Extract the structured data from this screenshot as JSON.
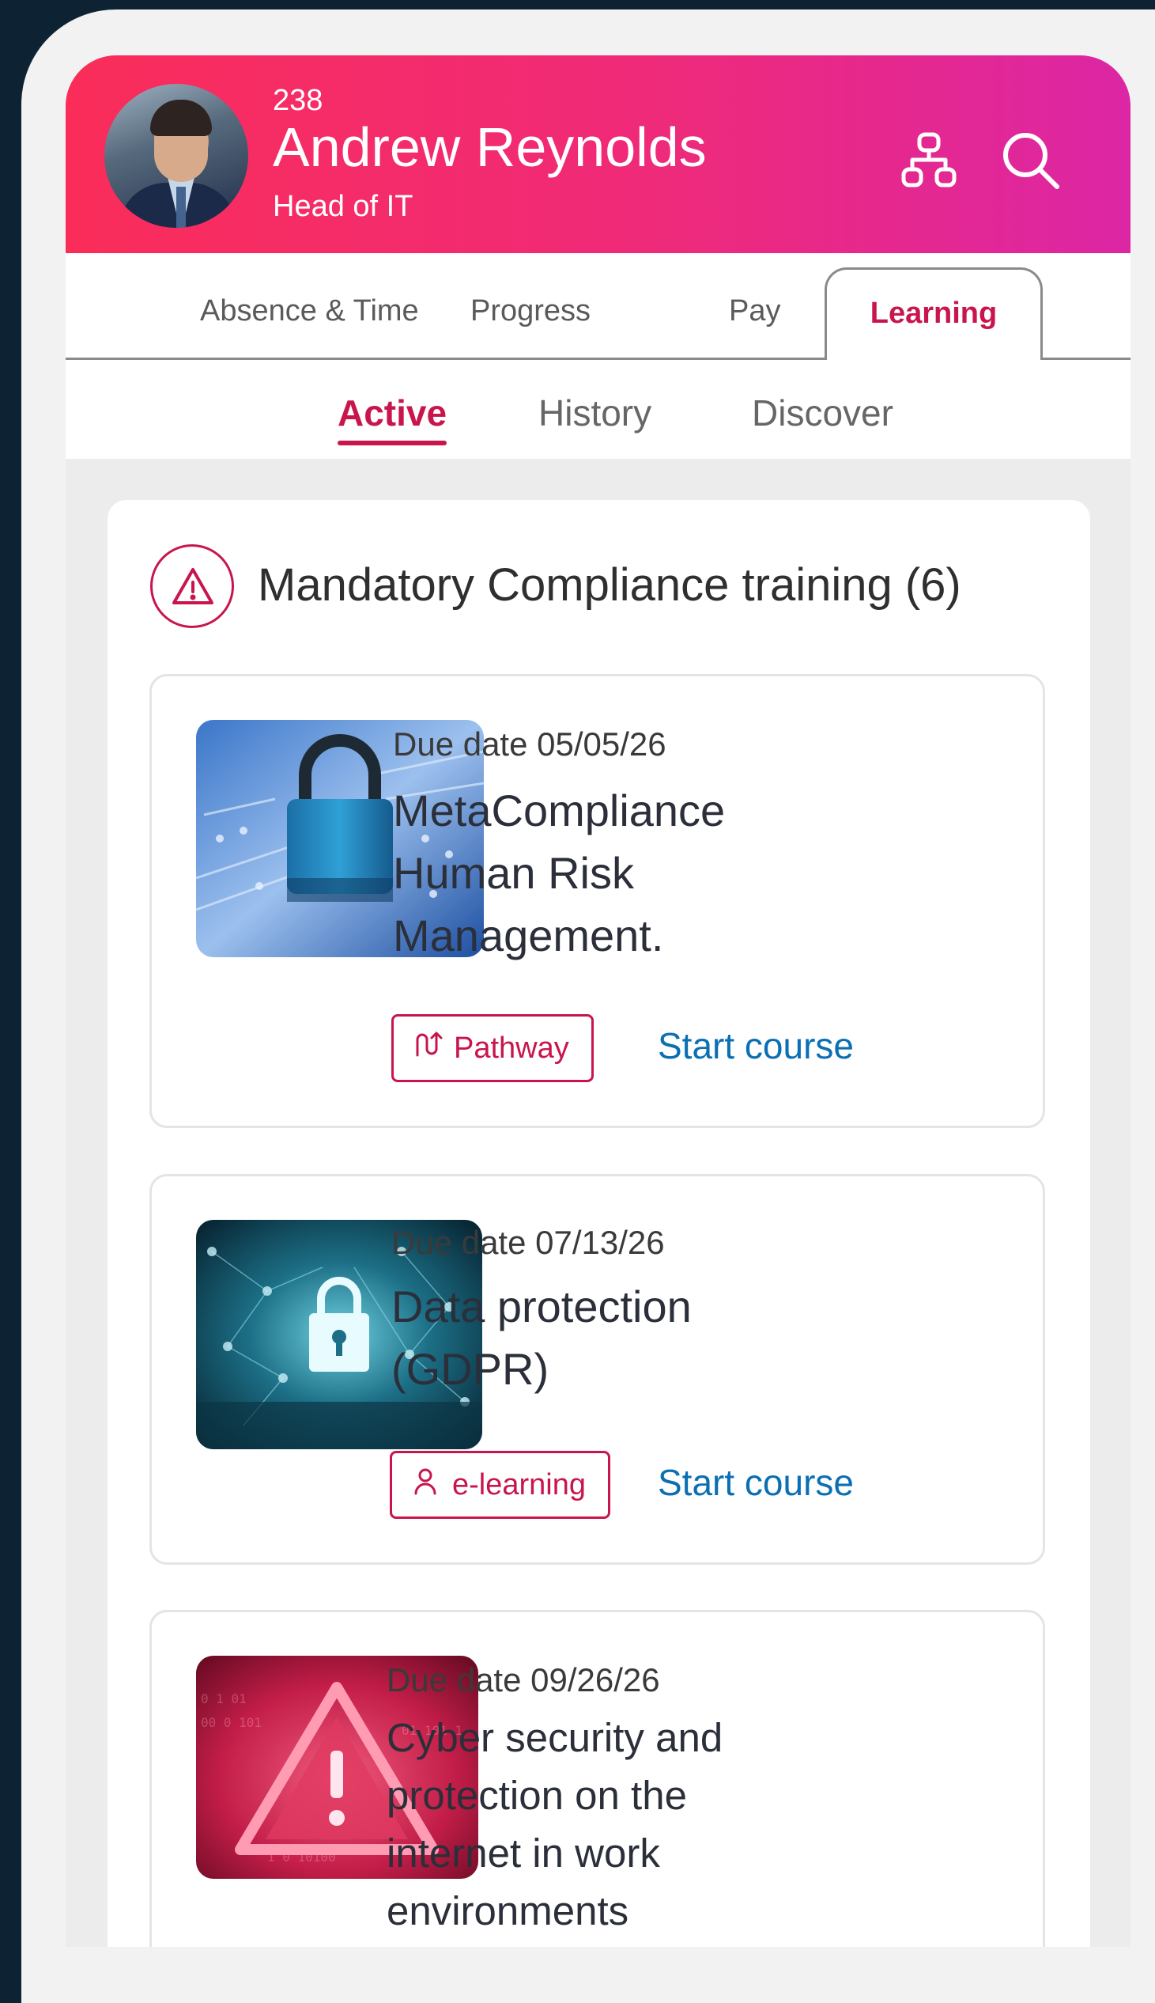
{
  "header": {
    "number": "238",
    "name": "Andrew Reynolds",
    "role": "Head of IT",
    "icons": [
      "org-chart-icon",
      "search-icon"
    ]
  },
  "tabs": [
    {
      "label": "Absence & Time",
      "active": false
    },
    {
      "label": "Progress",
      "active": false
    },
    {
      "label": "Pay",
      "active": false
    },
    {
      "label": "Learning",
      "active": true
    }
  ],
  "subtabs": [
    {
      "label": "Active",
      "active": true
    },
    {
      "label": "History",
      "active": false
    },
    {
      "label": "Discover",
      "active": false
    }
  ],
  "section": {
    "title": "Mandatory Compliance training (6)",
    "icon": "warning-icon"
  },
  "courses": [
    {
      "due": "Due date 05/05/26",
      "title_lines": [
        "MetaCompliance",
        "Human Risk",
        "Management."
      ],
      "type": "Pathway",
      "type_icon": "pathway-icon",
      "action": "Start course",
      "image": "padlock-circuit-image"
    },
    {
      "due": "Due date 07/13/26",
      "title_lines": [
        "Data protection",
        "(GDPR)"
      ],
      "type": "e-learning",
      "type_icon": "person-icon",
      "action": "Start course",
      "image": "network-lock-image"
    },
    {
      "due": "Due date 09/26/26",
      "title_lines": [
        "Cyber security and",
        "protection on the",
        "internet in work",
        "environments"
      ],
      "image": "warning-triangle-image"
    }
  ],
  "colors": {
    "accent": "#c8164c",
    "header_start": "#fa2d59",
    "header_end": "#dc26a4",
    "link": "#0b6fb4"
  }
}
